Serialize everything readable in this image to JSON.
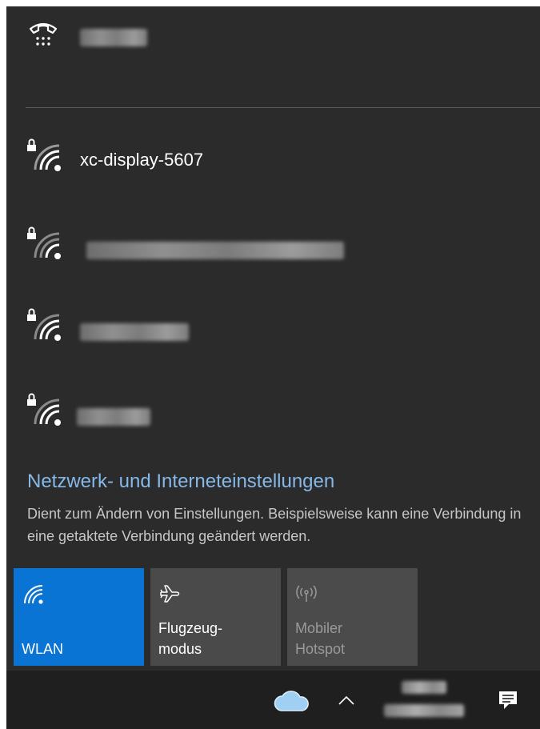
{
  "networks": {
    "dialup": {
      "name": "████"
    },
    "wifi": [
      {
        "name": "xc-display-5607",
        "secured": true
      },
      {
        "name": "████████████",
        "secured": true
      },
      {
        "name": "██████",
        "secured": true
      },
      {
        "name": "████",
        "secured": true
      }
    ]
  },
  "settings": {
    "link": "Netzwerk- und Interneteinstellungen",
    "description": "Dient zum Ändern von Einstellungen. Beispielsweise kann eine Verbindung in eine getaktete Verbindung geändert werden."
  },
  "quick_actions": [
    {
      "label_line1": "WLAN",
      "label_line2": "",
      "state": "on",
      "icon": "wifi-icon"
    },
    {
      "label_line1": "Flugzeug-",
      "label_line2": "modus",
      "state": "off",
      "icon": "airplane-icon"
    },
    {
      "label_line1": "Mobiler",
      "label_line2": "Hotspot",
      "state": "disabled",
      "icon": "hotspot-icon"
    }
  ],
  "taskbar": {
    "clock_time": "█████",
    "clock_date": "██████████",
    "icons": [
      "onedrive-cloud-icon",
      "chevron-up-icon",
      "action-center-icon"
    ]
  },
  "colors": {
    "flyout_bg": "#2b2b2b",
    "accent": "#0a74d4",
    "link": "#86b8e8",
    "taskbar_bg": "#1f1f1f"
  }
}
